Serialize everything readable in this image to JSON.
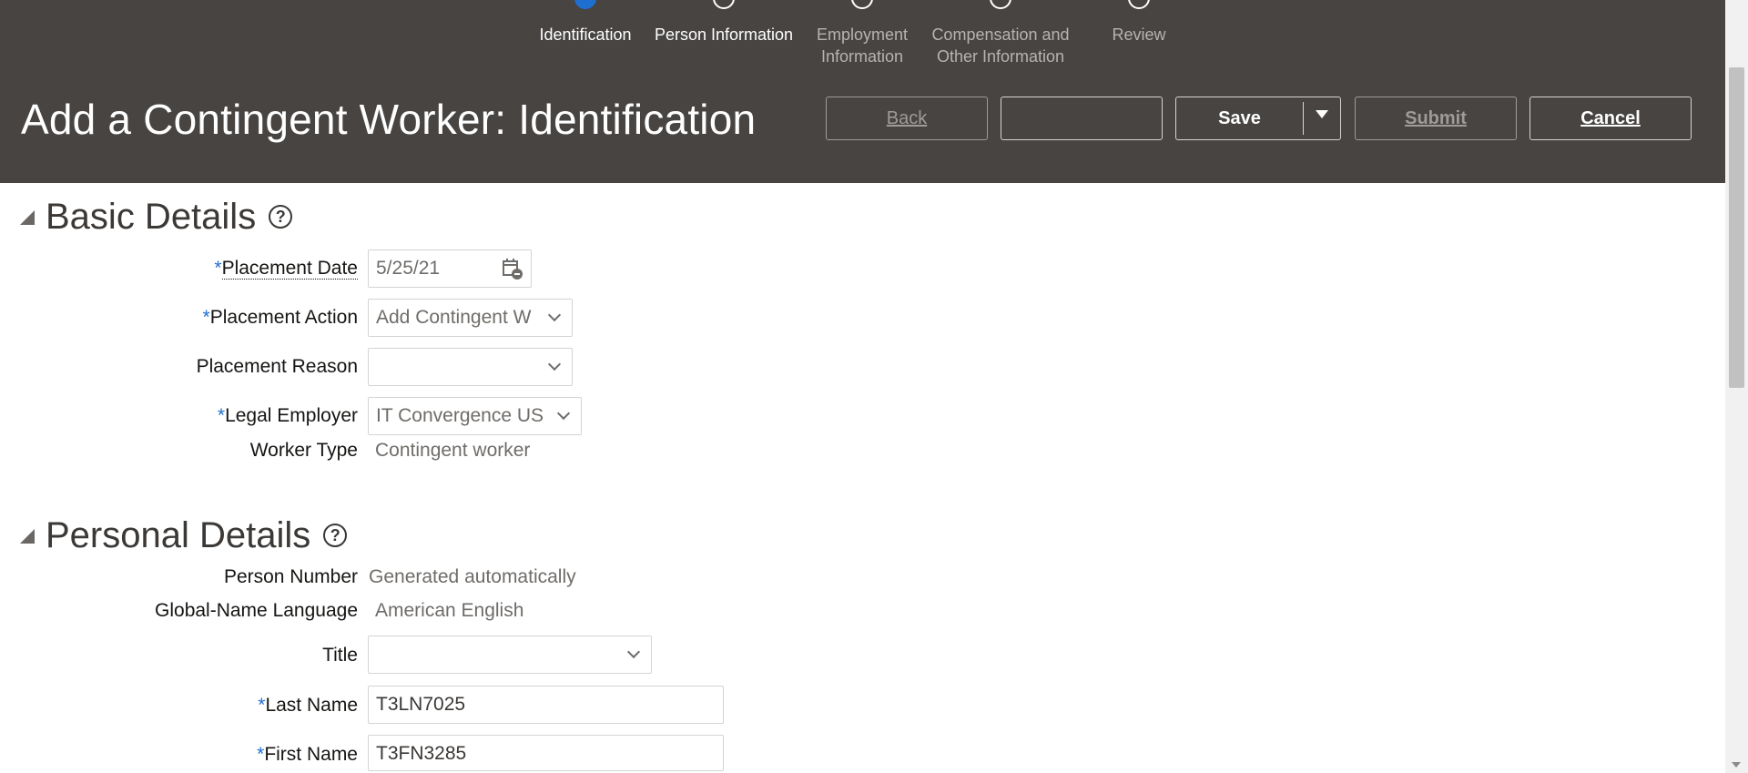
{
  "train": {
    "stops": [
      {
        "label": "Identification",
        "state": "active"
      },
      {
        "label": "Person Information",
        "state": "visited"
      },
      {
        "label": "Employment Information",
        "label_line1": "Employment",
        "label_line2": "Information",
        "state": "unvisited"
      },
      {
        "label": "Compensation and Other Information",
        "label_line1": "Compensation and",
        "label_line2": "Other Information",
        "state": "unvisited"
      },
      {
        "label": "Review",
        "state": "unvisited"
      }
    ]
  },
  "header": {
    "title": "Add a Contingent Worker: Identification",
    "buttons": {
      "back": "Back",
      "blank": "",
      "save": "Save",
      "submit": "Submit",
      "cancel": "Cancel"
    }
  },
  "basic_details": {
    "title": "Basic Details",
    "help_glyph": "?",
    "placement_date": {
      "label": "Placement Date",
      "required": "*",
      "value": "5/25/21"
    },
    "placement_action": {
      "label": "Placement Action",
      "required": "*",
      "value": "Add Contingent W"
    },
    "placement_reason": {
      "label": "Placement Reason",
      "value": ""
    },
    "legal_employer": {
      "label": "Legal Employer",
      "required": "*",
      "value": "IT Convergence US"
    },
    "worker_type": {
      "label": "Worker Type",
      "value": "Contingent worker"
    }
  },
  "personal_details": {
    "title": "Personal Details",
    "help_glyph": "?",
    "person_number": {
      "label": "Person Number",
      "value": "Generated automatically"
    },
    "global_name_language": {
      "label": "Global-Name Language",
      "value": "American English"
    },
    "title_field": {
      "label": "Title",
      "value": ""
    },
    "last_name": {
      "label": "Last Name",
      "required": "*",
      "value": "T3LN7025"
    },
    "first_name": {
      "label": "First Name",
      "required": "*",
      "value": "T3FN3285"
    }
  },
  "colors": {
    "header_bg": "#474442",
    "accent": "#1f6fd1",
    "required": "#1f6fd1"
  },
  "icons": [
    "calendar-icon",
    "chevron-down-icon",
    "help-icon",
    "disclosure-triangle-icon",
    "dropdown-arrow-icon"
  ]
}
